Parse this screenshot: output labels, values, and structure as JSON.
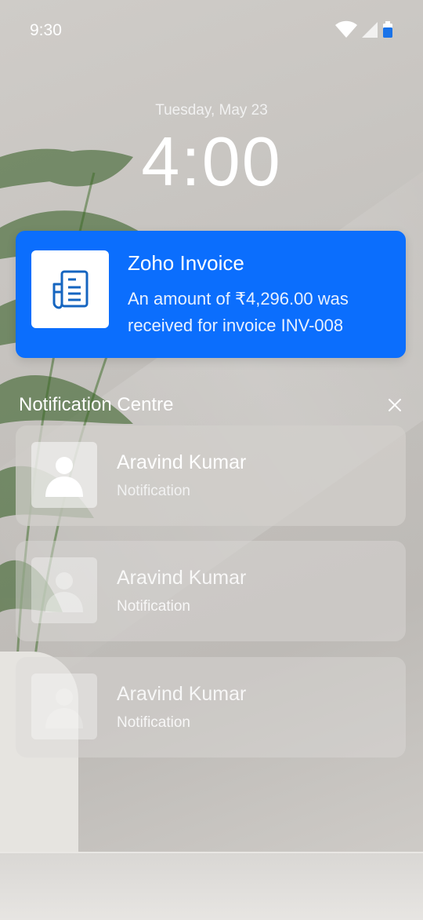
{
  "status_bar": {
    "time": "9:30",
    "icons": [
      "wifi-icon",
      "cellular-signal-icon",
      "battery-icon"
    ],
    "battery_color": "#1a73e8"
  },
  "lock_screen": {
    "date": "Tuesday, May 23",
    "clock": "4:00"
  },
  "invoice_notification": {
    "icon": "invoice-document-icon",
    "title": "Zoho Invoice",
    "message": "An amount of ₹4,296.00 was received for invoice INV-008",
    "accent_color": "#0b6efd"
  },
  "notification_centre": {
    "label": "Notification Centre",
    "close_icon": "close-icon",
    "items": [
      {
        "name": "Aravind Kumar",
        "subtitle": "Notification",
        "avatar": "person-icon"
      },
      {
        "name": "Aravind Kumar",
        "subtitle": "Notification",
        "avatar": "person-icon"
      },
      {
        "name": "Aravind Kumar",
        "subtitle": "Notification",
        "avatar": "person-icon"
      }
    ]
  }
}
